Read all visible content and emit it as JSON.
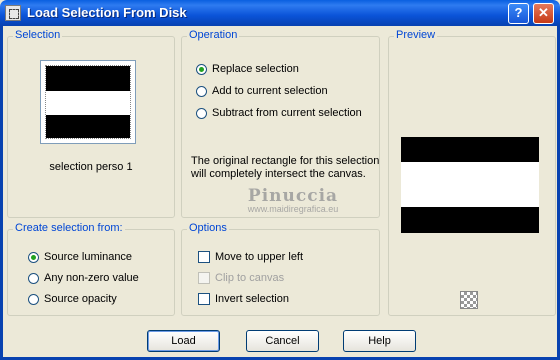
{
  "window": {
    "title": "Load Selection From Disk",
    "help_glyph": "?",
    "close_glyph": "✕"
  },
  "selection": {
    "group_label": "Selection",
    "filename": "selection perso 1"
  },
  "operation": {
    "group_label": "Operation",
    "options": [
      {
        "label": "Replace selection",
        "checked": true
      },
      {
        "label": "Add to current selection",
        "checked": false
      },
      {
        "label": "Subtract from current selection",
        "checked": false
      }
    ],
    "note_line1": "The original rectangle for this selection",
    "note_line2": "will completely intersect the canvas."
  },
  "preview": {
    "group_label": "Preview",
    "icon": "transparency-toggle-icon"
  },
  "create_from": {
    "group_label": "Create selection from:",
    "options": [
      {
        "label": "Source luminance",
        "checked": true
      },
      {
        "label": "Any non-zero value",
        "checked": false
      },
      {
        "label": "Source opacity",
        "checked": false
      }
    ]
  },
  "options": {
    "group_label": "Options",
    "move_upper_left": "Move to upper left",
    "clip_to_canvas": "Clip to canvas",
    "invert_selection": "Invert selection"
  },
  "watermark": {
    "name": "Pinuccia",
    "site": "www.maidiregrafica.eu"
  },
  "buttons": {
    "load": "Load",
    "cancel": "Cancel",
    "help": "Help"
  },
  "colors": {
    "title_bar": "#0A53D8",
    "group_label": "#0046D5",
    "radio_dot": "#21A121",
    "dialog_bg": "#ECE9D8"
  }
}
